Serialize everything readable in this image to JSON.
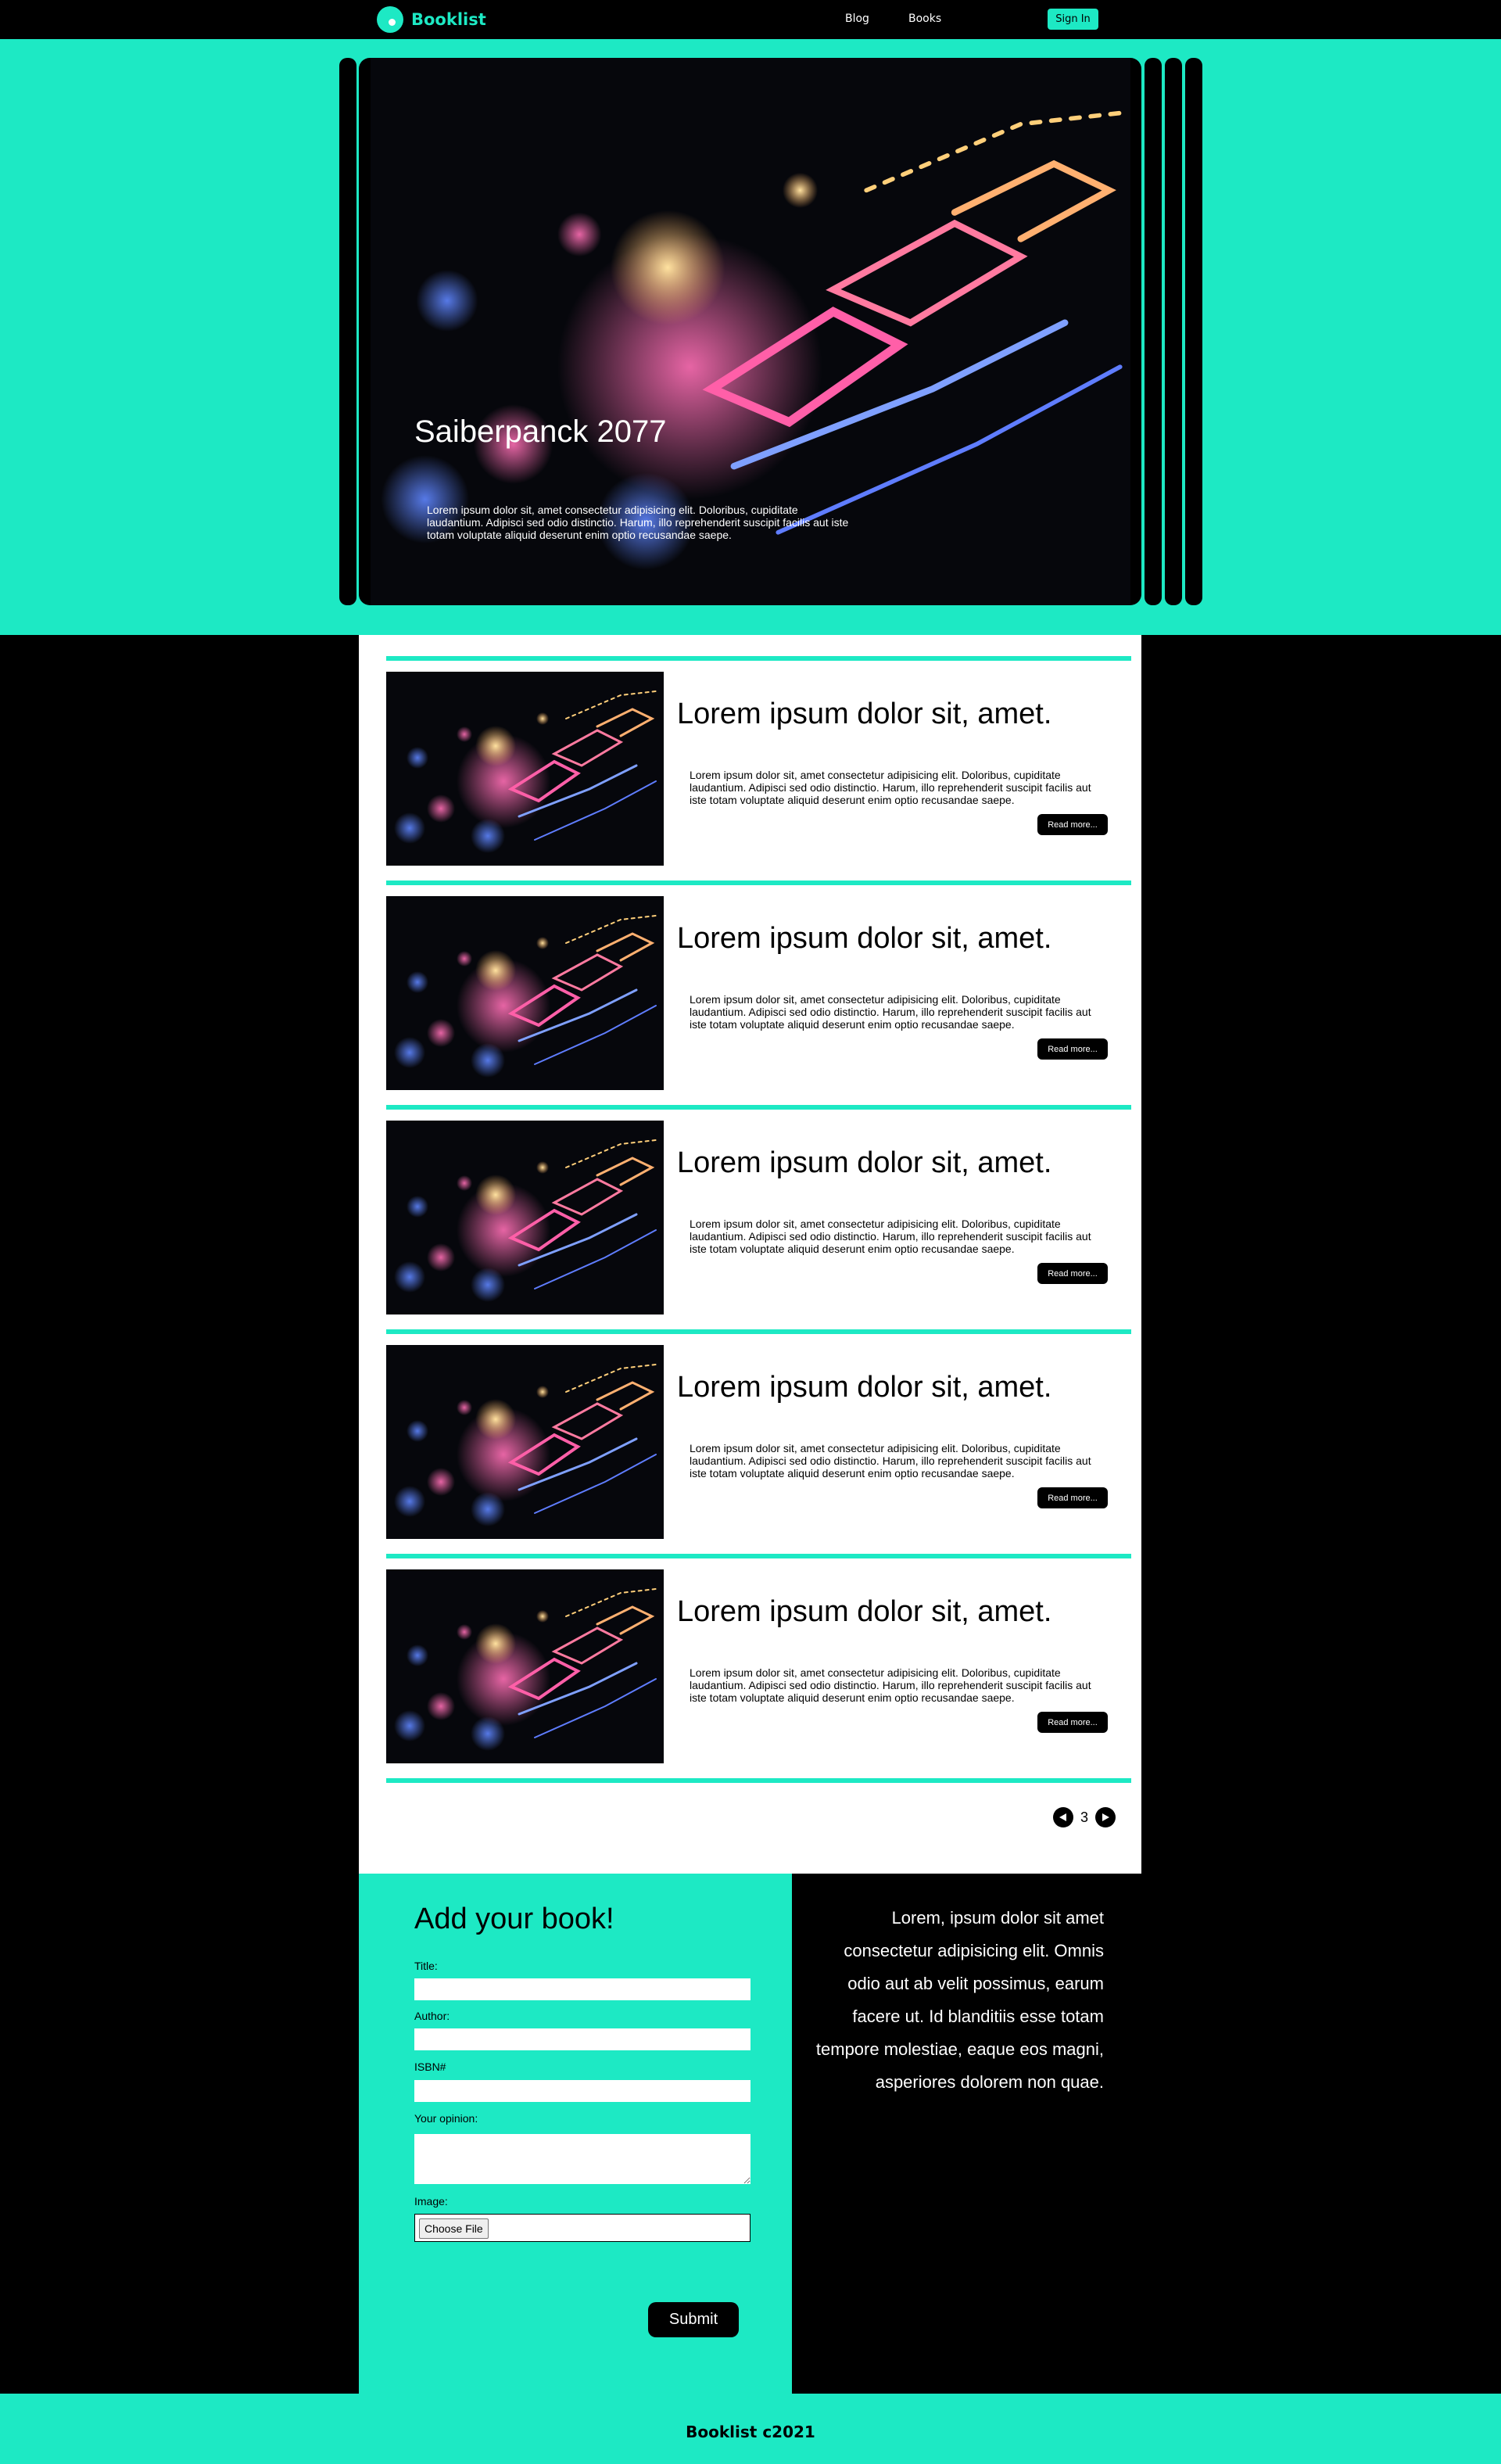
{
  "nav": {
    "brand": "Booklist",
    "links": [
      "Blog",
      "Books"
    ],
    "sign_in": "Sign In"
  },
  "hero": {
    "title": "Saiberpanck 2077",
    "text": "Lorem ipsum dolor sit, amet consectetur adipisicing elit. Doloribus, cupiditate laudantium. Adipisci sed odio distinctio. Harum, illo reprehenderit suscipit facilis aut iste totam voluptate aliquid deserunt enim optio recusandae saepe."
  },
  "articles": [
    {
      "title": "Lorem ipsum dolor sit, amet.",
      "text": "Lorem ipsum dolor sit, amet consectetur adipisicing elit. Doloribus, cupiditate laudantium. Adipisci sed odio distinctio. Harum, illo reprehenderit suscipit facilis aut iste totam voluptate aliquid deserunt enim optio recusandae saepe.",
      "button": "Read more..."
    },
    {
      "title": "Lorem ipsum dolor sit, amet.",
      "text": "Lorem ipsum dolor sit, amet consectetur adipisicing elit. Doloribus, cupiditate laudantium. Adipisci sed odio distinctio. Harum, illo reprehenderit suscipit facilis aut iste totam voluptate aliquid deserunt enim optio recusandae saepe.",
      "button": "Read more..."
    },
    {
      "title": "Lorem ipsum dolor sit, amet.",
      "text": "Lorem ipsum dolor sit, amet consectetur adipisicing elit. Doloribus, cupiditate laudantium. Adipisci sed odio distinctio. Harum, illo reprehenderit suscipit facilis aut iste totam voluptate aliquid deserunt enim optio recusandae saepe.",
      "button": "Read more..."
    },
    {
      "title": "Lorem ipsum dolor sit, amet.",
      "text": "Lorem ipsum dolor sit, amet consectetur adipisicing elit. Doloribus, cupiditate laudantium. Adipisci sed odio distinctio. Harum, illo reprehenderit suscipit facilis aut iste totam voluptate aliquid deserunt enim optio recusandae saepe.",
      "button": "Read more..."
    },
    {
      "title": "Lorem ipsum dolor sit, amet.",
      "text": "Lorem ipsum dolor sit, amet consectetur adipisicing elit. Doloribus, cupiditate laudantium. Adipisci sed odio distinctio. Harum, illo reprehenderit suscipit facilis aut iste totam voluptate aliquid deserunt enim optio recusandae saepe.",
      "button": "Read more..."
    }
  ],
  "pagination": {
    "page": "3",
    "prev_icon": "triangle-left-icon",
    "next_icon": "triangle-right-icon"
  },
  "form": {
    "title": "Add your book!",
    "labels": {
      "title": "Title:",
      "author": "Author:",
      "isbn": "ISBN#",
      "opinion": "Your opinion:",
      "image": "Image:"
    },
    "choose_file": "Choose File",
    "submit": "Submit"
  },
  "side_text": "Lorem, ipsum dolor sit amet consectetur adipisicing elit. Omnis odio aut ab velit possimus, earum facere ut. Id blanditiis esse totam tempore molestiae, eaque eos magni, asperiores dolorem non quae.",
  "footer": {
    "text": "Booklist  c2021"
  },
  "colors": {
    "accent": "#1de9c4",
    "dark": "#000000",
    "light": "#ffffff"
  }
}
